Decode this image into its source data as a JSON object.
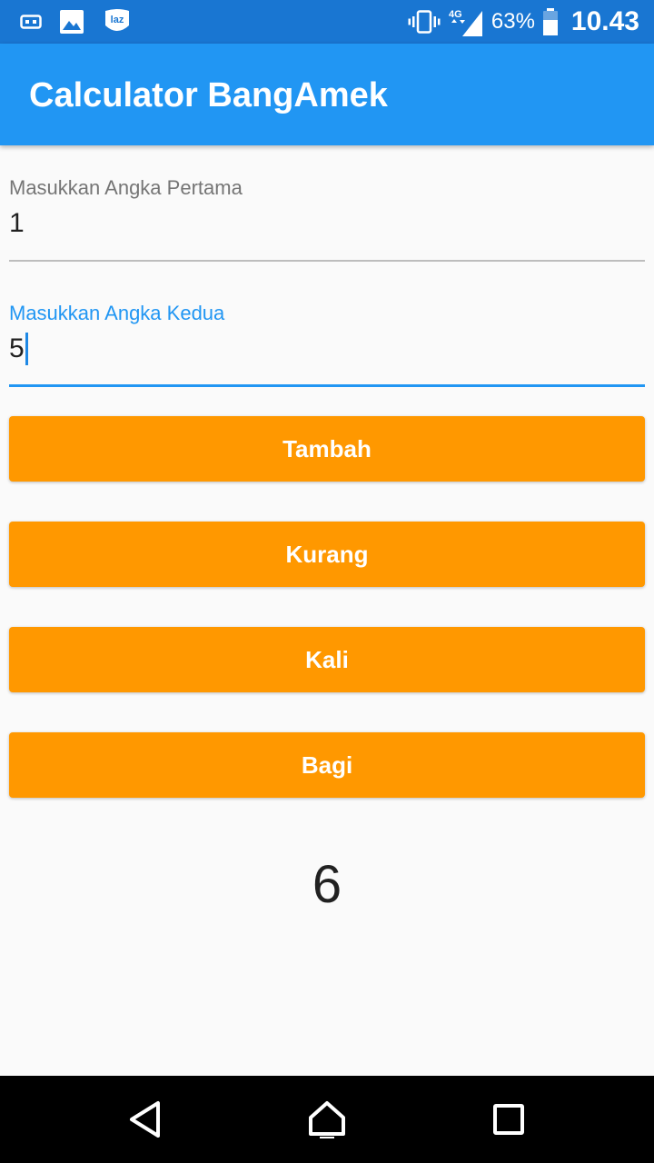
{
  "status_bar": {
    "left_icons": [
      "voicemail-icon",
      "image-icon",
      "lazada-icon"
    ],
    "lazada_badge": "laz",
    "network": "4G",
    "battery_percent": "63%",
    "battery_level": 0.63,
    "time": "10.43"
  },
  "app_bar": {
    "title": "Calculator BangAmek"
  },
  "form": {
    "first": {
      "label": "Masukkan Angka Pertama",
      "value": "1"
    },
    "second": {
      "label": "Masukkan Angka Kedua",
      "value": "5",
      "focused": true
    }
  },
  "buttons": {
    "add": "Tambah",
    "subtract": "Kurang",
    "multiply": "Kali",
    "divide": "Bagi"
  },
  "result": "6",
  "nav_bar": {
    "icons": [
      "back-icon",
      "home-icon",
      "recents-icon"
    ]
  },
  "colors": {
    "status_bar": "#1976d2",
    "app_bar": "#2196f3",
    "button": "#ff9800",
    "focus": "#2196f3",
    "background": "#fafafa"
  }
}
